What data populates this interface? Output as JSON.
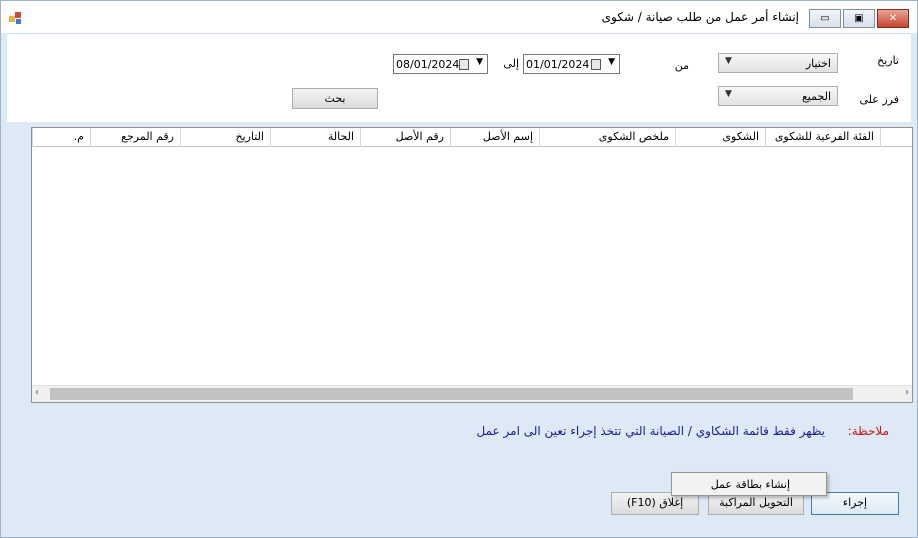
{
  "window": {
    "title": "إنشاء أمر عمل من طلب صيانة / شكوى",
    "minimize_glyph": "▭",
    "maximize_glyph": "▣",
    "close_glyph": "✕"
  },
  "filters": {
    "date_label": "تاريخ",
    "from_label": "من",
    "to_label": "إلى",
    "date_type_value": "اختيار",
    "from_date": "01/01/2024",
    "to_date": "08/01/2024",
    "sort_label": "فرز على",
    "sort_value": "الجميع",
    "search_button": "بحث"
  },
  "grid": {
    "columns": [
      "الفئة الفرعية للشكوى",
      "الشكوى",
      "ملخص الشكوى",
      "إسم الأصل",
      "رقم الأصل",
      "الحالة",
      "التاريخ",
      "رقم المرجع",
      "م."
    ],
    "rows": []
  },
  "note": {
    "label": "ملاحظة:",
    "text": "يظهر فقط قائمة الشكاوي / الصيانة التي تتخذ إجراء تعين الى امر عمل"
  },
  "buttons": {
    "action": "إجراء",
    "details": "التحويل المراكبة",
    "close": "إغلاق (F10)"
  },
  "context_menu": {
    "item": "إنشاء بطاقة عمل"
  },
  "colors": {
    "note_label": "#d01010",
    "note_text": "#1a1aa8",
    "window_bg": "#dde9f5"
  }
}
